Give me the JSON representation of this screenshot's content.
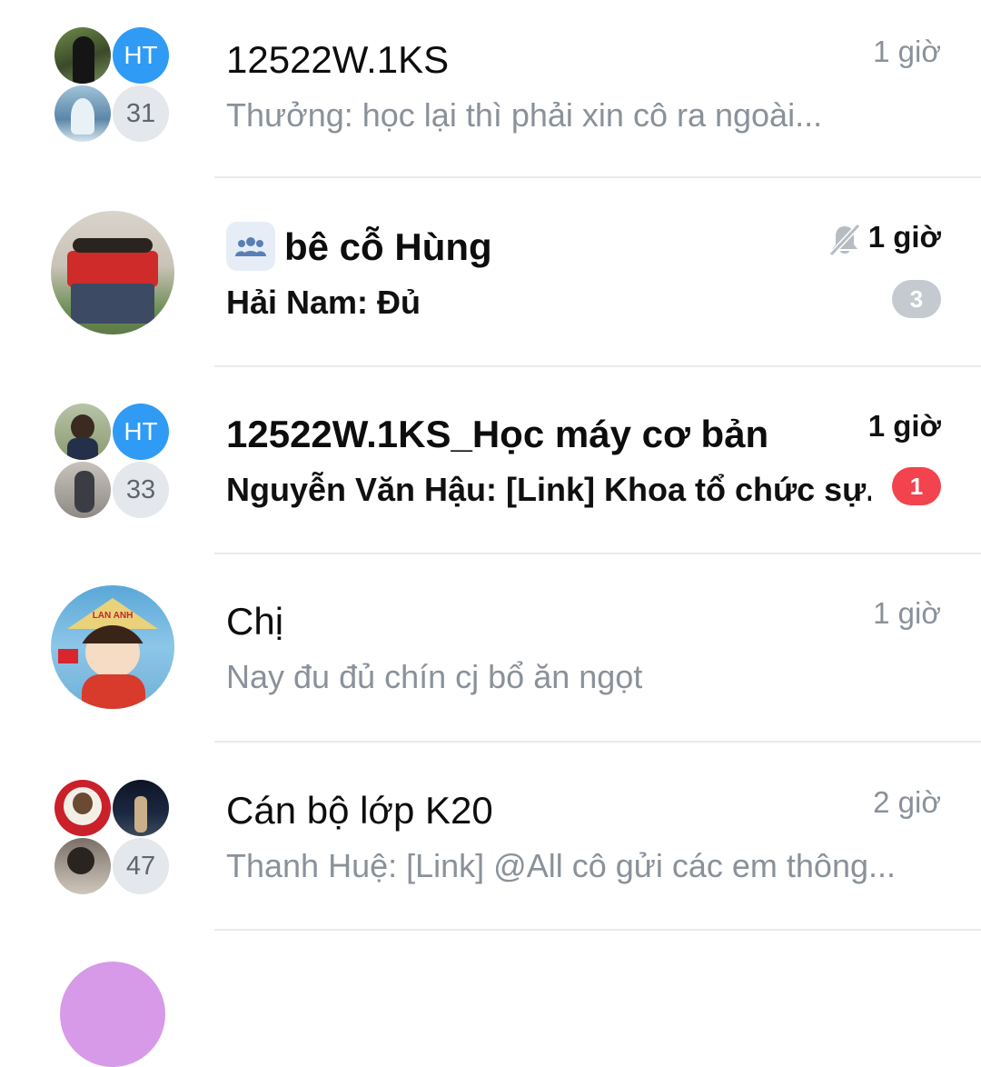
{
  "conversations": [
    {
      "title": "12522W.1KS",
      "preview": "Thưởng: học lại thì phải xin cô ra ngoài...",
      "time": "1 giờ",
      "avatar": {
        "type": "group-grid",
        "initials": "HT",
        "member_count": "31"
      }
    },
    {
      "title": "bê cỗ Hùng",
      "preview": "Hải Nam: Đủ",
      "time": "1 giờ",
      "unread": "3",
      "muted": true,
      "group_icon": "people-icon",
      "avatar": {
        "type": "photo",
        "subject": "group-photo"
      }
    },
    {
      "title": "12522W.1KS_Học máy cơ bản",
      "preview": "Nguyễn Văn Hậu: [Link] Khoa tổ chức sự...",
      "time": "1 giờ",
      "unread": "1",
      "avatar": {
        "type": "group-grid",
        "initials": "HT",
        "member_count": "33"
      }
    },
    {
      "title": "Chị",
      "preview": "Nay đu đủ chín cj bổ ăn ngọt",
      "time": "1 giờ",
      "avatar": {
        "type": "photo",
        "subject": "cartoon-girl",
        "hat_text": "LAN ANH"
      }
    },
    {
      "title": "Cán bộ lớp K20",
      "preview": "Thanh Huệ: [Link] @All cô gửi các em thông...",
      "time": "2 giờ",
      "avatar": {
        "type": "group-grid",
        "member_count": "47"
      }
    }
  ],
  "colors": {
    "accent": "#2f9bf4",
    "unread_red": "#f2434f",
    "muted_badge": "#c5cad0",
    "secondary_text": "#8a9199"
  }
}
